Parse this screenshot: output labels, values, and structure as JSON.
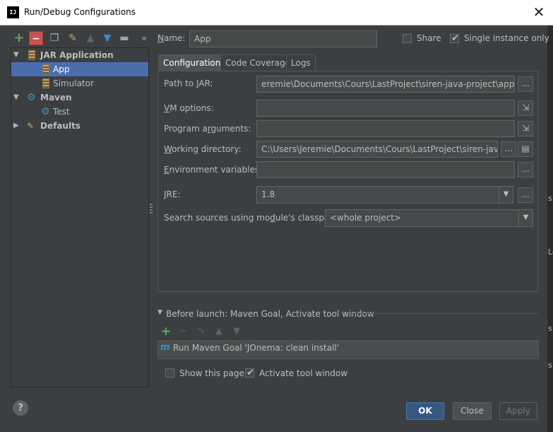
{
  "window": {
    "title": "Run/Debug Configurations",
    "app_icon": "IJ",
    "close": "✕"
  },
  "toolbar": {
    "more": "»"
  },
  "tree": {
    "items": [
      {
        "label": "JAR Application",
        "level": 0,
        "expanded": true,
        "icon": "jar-icon",
        "bold": true
      },
      {
        "label": "App",
        "level": 1,
        "selected": true,
        "icon": "jar-icon"
      },
      {
        "label": "Simulator",
        "level": 1,
        "icon": "jar-icon"
      },
      {
        "label": "Maven",
        "level": 0,
        "expanded": true,
        "icon": "gear-icon",
        "bold": true
      },
      {
        "label": "Test",
        "level": 1,
        "icon": "gear-icon"
      },
      {
        "label": "Defaults",
        "level": 0,
        "expanded": false,
        "icon": "wrench-icon",
        "bold": true
      }
    ]
  },
  "header": {
    "name_label": "Name:",
    "name_value": "App",
    "share_label": "Share",
    "share_checked": false,
    "single_instance_label": "Single instance only",
    "single_instance_checked": true
  },
  "tabs": [
    {
      "label": "Configuration",
      "active": true
    },
    {
      "label": "Code Coverage",
      "active": false
    },
    {
      "label": "Logs",
      "active": false
    }
  ],
  "config": {
    "path_to_jar_label": "Path to JAR:",
    "path_to_jar_value": "eremie\\Documents\\Cours\\LastProject\\siren-java-project\\app\\build",
    "vm_options_label": "VM options:",
    "vm_options_value": "",
    "program_args_label": "Program arguments:",
    "program_args_value": "",
    "working_dir_label": "Working directory:",
    "working_dir_value": "C:\\Users\\Jeremie\\Documents\\Cours\\LastProject\\siren-java-pro",
    "env_vars_label": "Environment variables:",
    "env_vars_value": "",
    "jre_label": "JRE:",
    "jre_value": "1.8",
    "search_sources_label": "Search sources using module's classpath:",
    "search_sources_value": "<whole project>",
    "browse": "..."
  },
  "before_launch": {
    "header": "Before launch: Maven Goal, Activate tool window",
    "task": "Run Maven Goal 'JOnema: clean install'",
    "show_page_label": "Show this page",
    "show_page_checked": false,
    "activate_label": "Activate tool window",
    "activate_checked": true
  },
  "buttons": {
    "ok": "OK",
    "close": "Close",
    "apply": "Apply",
    "help": "?"
  },
  "side_strip": [
    "s",
    "Le",
    "s",
    "s"
  ],
  "colors": {
    "accent": "#4b6eaf",
    "ok": "#365880",
    "add": "#59a869",
    "remove": "#c75450"
  }
}
